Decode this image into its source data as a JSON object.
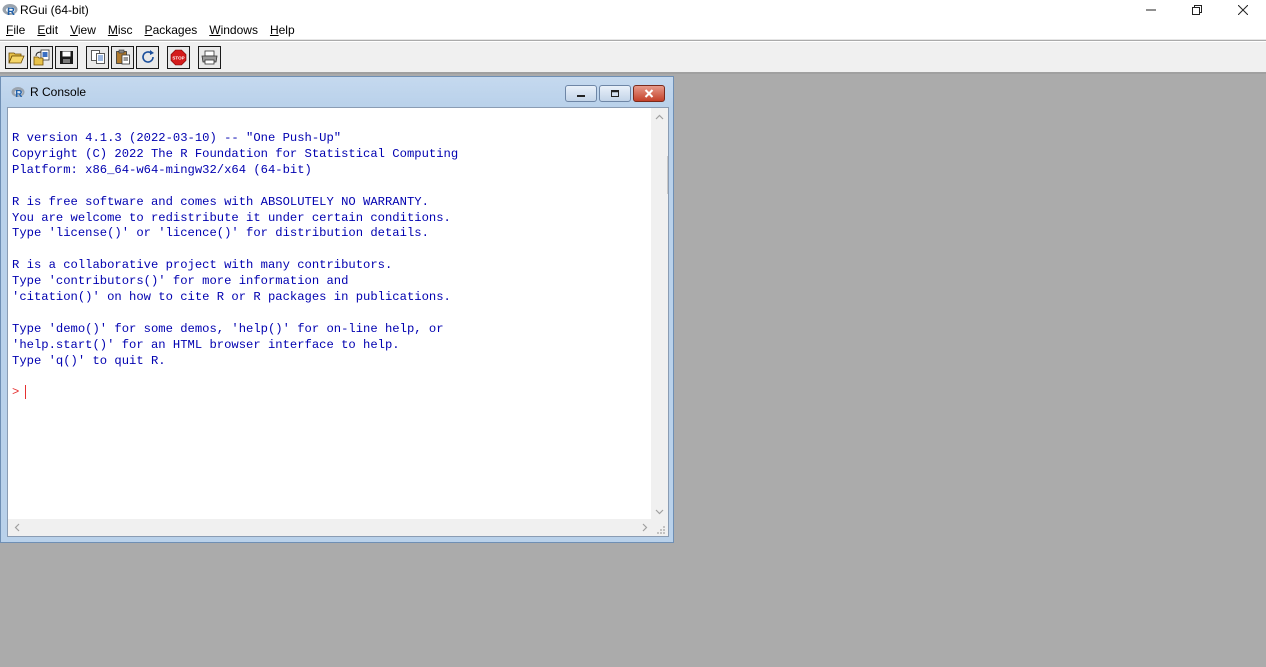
{
  "app": {
    "title": "RGui (64-bit)"
  },
  "menu": {
    "items": [
      {
        "label": "File",
        "underline": "F",
        "rest": "ile"
      },
      {
        "label": "Edit",
        "underline": "E",
        "rest": "dit"
      },
      {
        "label": "View",
        "underline": "V",
        "rest": "iew"
      },
      {
        "label": "Misc",
        "underline": "M",
        "rest": "isc"
      },
      {
        "label": "Packages",
        "underline": "P",
        "rest": "ackages"
      },
      {
        "label": "Windows",
        "underline": "W",
        "rest": "indows"
      },
      {
        "label": "Help",
        "underline": "H",
        "rest": "elp"
      }
    ]
  },
  "toolbar": {
    "buttons": [
      "open-script-icon",
      "load-workspace-icon",
      "save-icon",
      "copy-icon",
      "paste-icon",
      "refresh-icon",
      "stop-icon",
      "print-icon"
    ]
  },
  "console": {
    "title": "R Console",
    "text": "R version 4.1.3 (2022-03-10) -- \"One Push-Up\"\nCopyright (C) 2022 The R Foundation for Statistical Computing\nPlatform: x86_64-w64-mingw32/x64 (64-bit)\n\nR is free software and comes with ABSOLUTELY NO WARRANTY.\nYou are welcome to redistribute it under certain conditions.\nType 'license()' or 'licence()' for distribution details.\n\nR is a collaborative project with many contributors.\nType 'contributors()' for more information and\n'citation()' on how to cite R or R packages in publications.\n\nType 'demo()' for some demos, 'help()' for on-line help, or\n'help.start()' for an HTML browser interface to help.\nType 'q()' to quit R.",
    "prompt": ">"
  },
  "colors": {
    "output_text": "#0000b0",
    "prompt": "#e53030",
    "mdi_background": "#ababab"
  }
}
